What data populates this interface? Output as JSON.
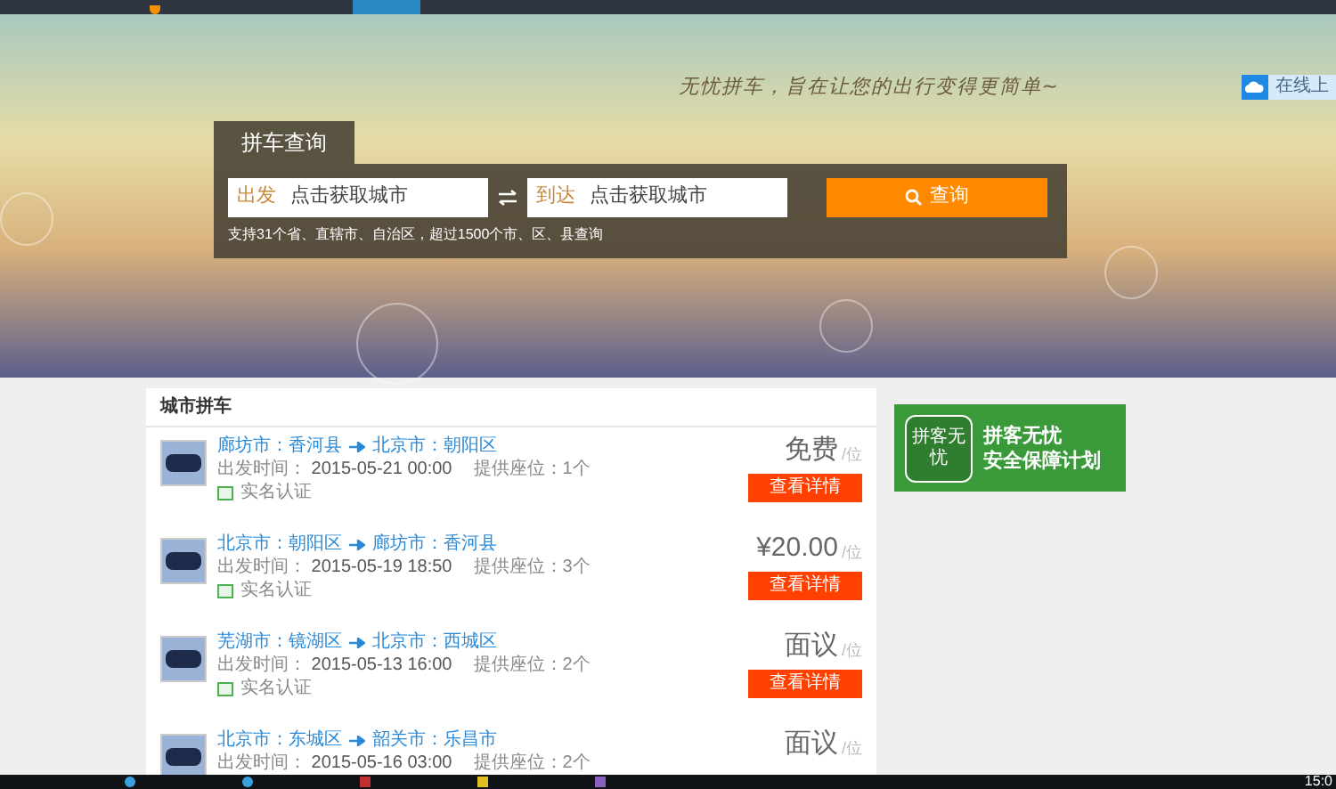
{
  "banner": {
    "slogan": "无忧拼车，旨在让您的出行变得更简单~",
    "side_tab": "在线上"
  },
  "search": {
    "tab": "拼车查询",
    "from_label": "出发",
    "from_placeholder": "点击获取城市",
    "to_label": "到达",
    "to_placeholder": "点击获取城市",
    "button": "查询",
    "note": "支持31个省、直辖市、自治区，超过1500个市、区、县查询"
  },
  "list": {
    "title": "城市拼车",
    "rows": [
      {
        "from": "廊坊市：香河县",
        "to": "北京市：朝阳区",
        "time_label": "出发时间：",
        "time": "2015-05-21 00:00",
        "seats": "提供座位：1个",
        "verified": "实名认证",
        "price": "免费",
        "unit": "/位",
        "button": "查看详情"
      },
      {
        "from": "北京市：朝阳区",
        "to": "廊坊市：香河县",
        "time_label": "出发时间：",
        "time": "2015-05-19 18:50",
        "seats": "提供座位：3个",
        "verified": "实名认证",
        "price": "¥20.00",
        "unit": "/位",
        "button": "查看详情"
      },
      {
        "from": "芜湖市：镜湖区",
        "to": "北京市：西城区",
        "time_label": "出发时间：",
        "time": "2015-05-13 16:00",
        "seats": "提供座位：2个",
        "verified": "实名认证",
        "price": "面议",
        "unit": "/位",
        "button": "查看详情"
      },
      {
        "from": "北京市：东城区",
        "to": "韶关市：乐昌市",
        "time_label": "出发时间：",
        "time": "2015-05-16 03:00",
        "seats": "提供座位：2个",
        "price": "面议",
        "unit": "/位"
      }
    ]
  },
  "ad": {
    "badge": "拼客无忧",
    "line1": "拼客无忧",
    "line2": "安全保障计划"
  },
  "taskbar": {
    "clock": "15:0"
  }
}
